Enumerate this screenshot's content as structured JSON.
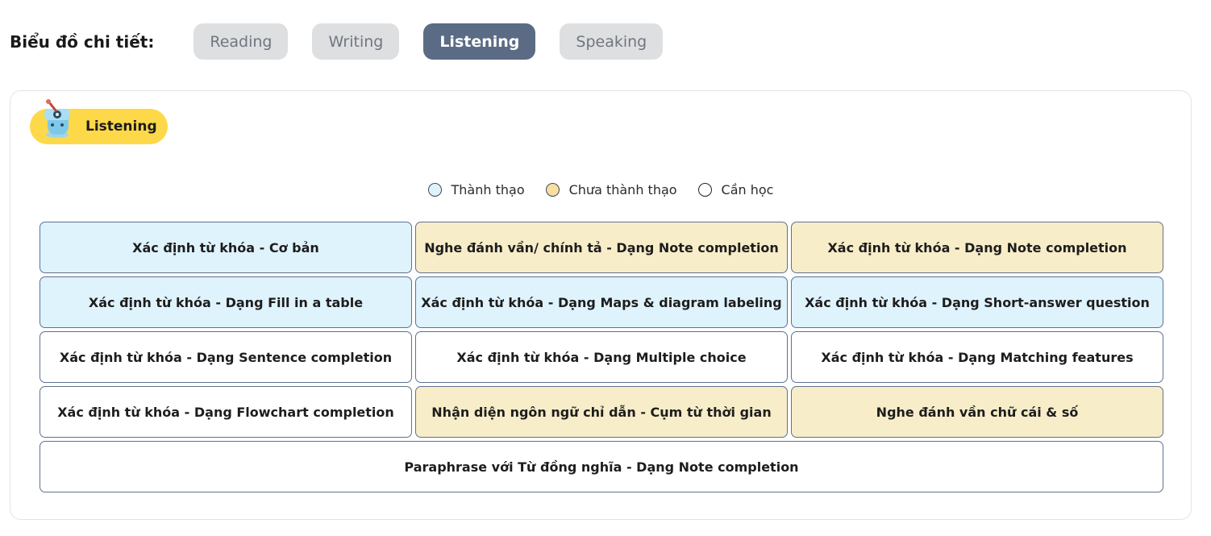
{
  "header": {
    "label": "Biểu đồ chi tiết:",
    "tabs": [
      {
        "label": "Reading",
        "active": false
      },
      {
        "label": "Writing",
        "active": false
      },
      {
        "label": "Listening",
        "active": true
      },
      {
        "label": "Speaking",
        "active": false
      }
    ]
  },
  "panel": {
    "badge_label": "Listening",
    "mascot_icon": "mascot-icon",
    "legend": [
      {
        "label": "Thành thạo",
        "status": "mastered"
      },
      {
        "label": "Chưa thành thạo",
        "status": "notyet"
      },
      {
        "label": "Cần học",
        "status": "learn"
      }
    ],
    "colors": {
      "mastered": "#dff3fd",
      "notyet": "#f8edc9",
      "learn": "#ffffff",
      "badge": "#fdd94a",
      "active_tab": "#5b6b85"
    },
    "skills": [
      {
        "label": "Xác định từ khóa - Cơ bản",
        "status": "mastered"
      },
      {
        "label": "Nghe đánh vần/ chính tả - Dạng Note completion",
        "status": "notyet"
      },
      {
        "label": "Xác định từ khóa - Dạng Note completion",
        "status": "notyet"
      },
      {
        "label": "Xác định từ khóa - Dạng Fill in a table",
        "status": "mastered"
      },
      {
        "label": "Xác định từ khóa - Dạng Maps & diagram labeling",
        "status": "mastered"
      },
      {
        "label": "Xác định từ khóa - Dạng Short-answer question",
        "status": "mastered"
      },
      {
        "label": "Xác định từ khóa - Dạng Sentence completion",
        "status": "learn"
      },
      {
        "label": "Xác định từ khóa - Dạng Multiple choice",
        "status": "learn"
      },
      {
        "label": "Xác định từ khóa - Dạng Matching features",
        "status": "learn"
      },
      {
        "label": "Xác định từ khóa - Dạng Flowchart completion",
        "status": "learn"
      },
      {
        "label": "Nhận diện ngôn ngữ chỉ dẫn - Cụm từ thời gian",
        "status": "notyet"
      },
      {
        "label": "Nghe đánh vần chữ cái & số",
        "status": "notyet"
      },
      {
        "label": "Paraphrase với Từ đồng nghĩa - Dạng Note completion",
        "status": "learn"
      }
    ]
  }
}
